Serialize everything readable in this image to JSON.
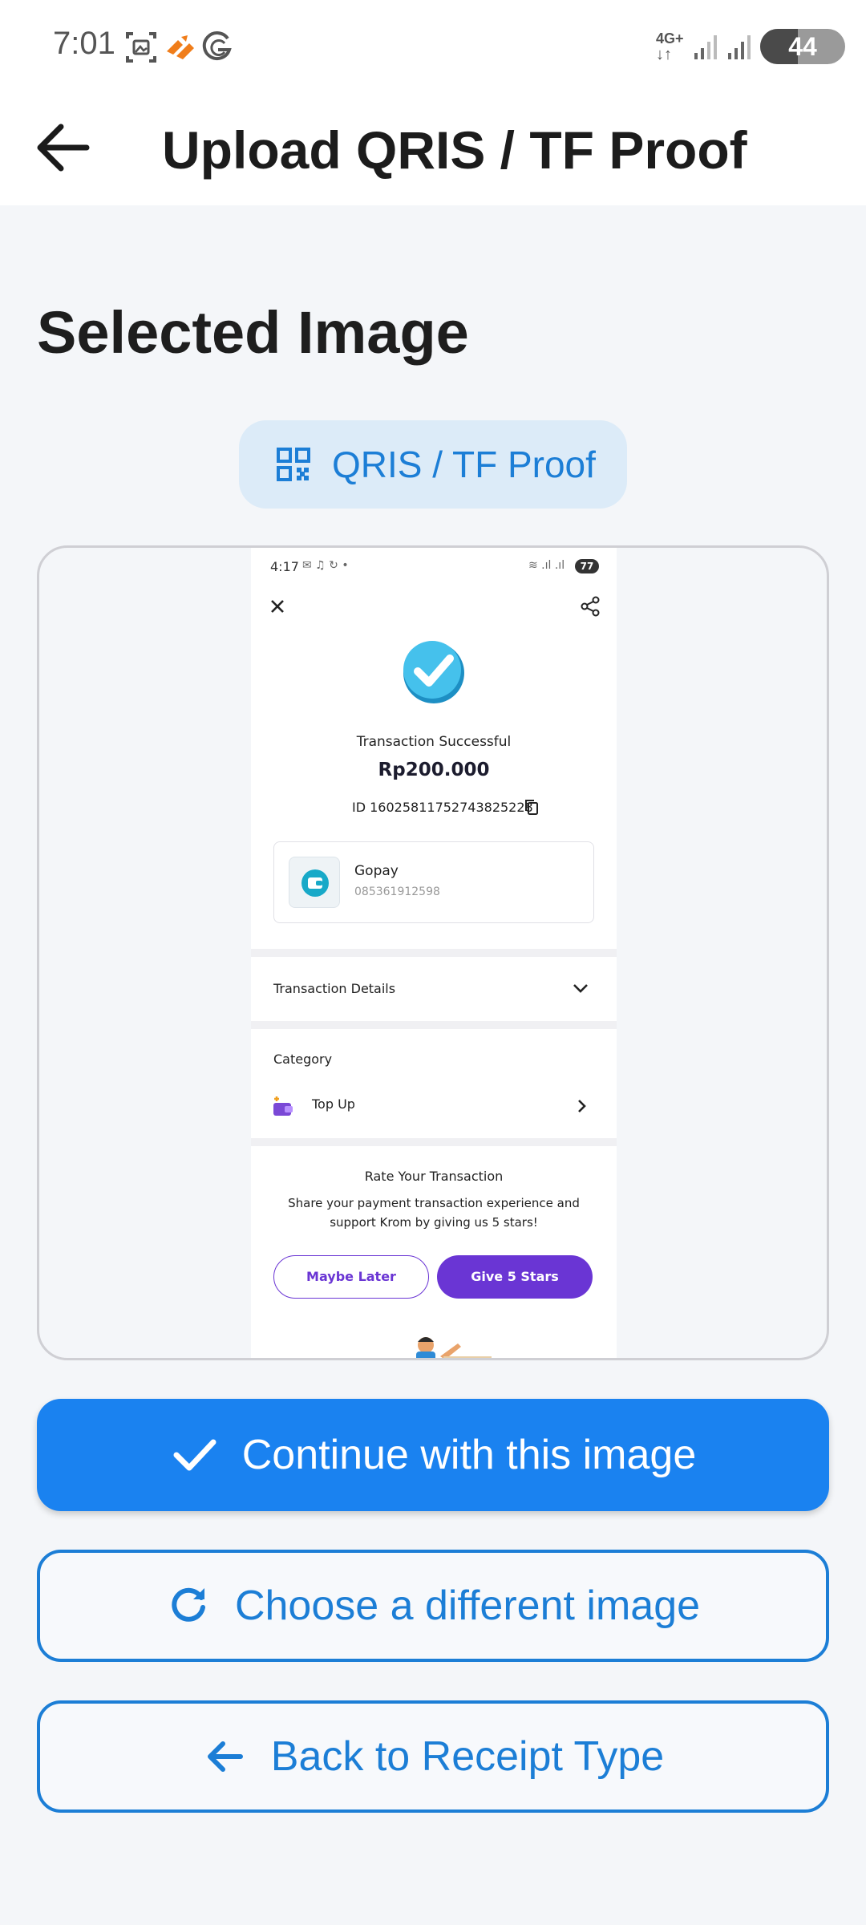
{
  "status_bar": {
    "time": "7:01",
    "network": "4G+",
    "battery": "44",
    "battery_level": 0.44
  },
  "app_bar": {
    "title": "Upload QRIS / TF Proof"
  },
  "main": {
    "section_title": "Selected Image",
    "chip_label": "QRIS / TF Proof"
  },
  "preview": {
    "status_time": "4:17",
    "status_battery": "77",
    "status_text": "Transaction Successful",
    "amount": "Rp200.000",
    "transaction_id": "ID 16025811752743825228",
    "wallet_name": "Gopay",
    "wallet_phone": "085361912598",
    "details_label": "Transaction Details",
    "category_heading": "Category",
    "category_value": "Top Up",
    "rate_title": "Rate Your Transaction",
    "rate_line1": "Share your payment transaction experience and",
    "rate_line2": "support Krom by giving us 5 stars!",
    "maybe_later": "Maybe Later",
    "give_stars": "Give 5 Stars"
  },
  "buttons": {
    "continue": "Continue with this image",
    "choose": "Choose a different image",
    "back": "Back to Receipt Type"
  },
  "colors": {
    "primary": "#1a82f0",
    "accent_text": "#1c7ed6",
    "chip_bg": "#dcebf8",
    "purple": "#6a35d4"
  }
}
